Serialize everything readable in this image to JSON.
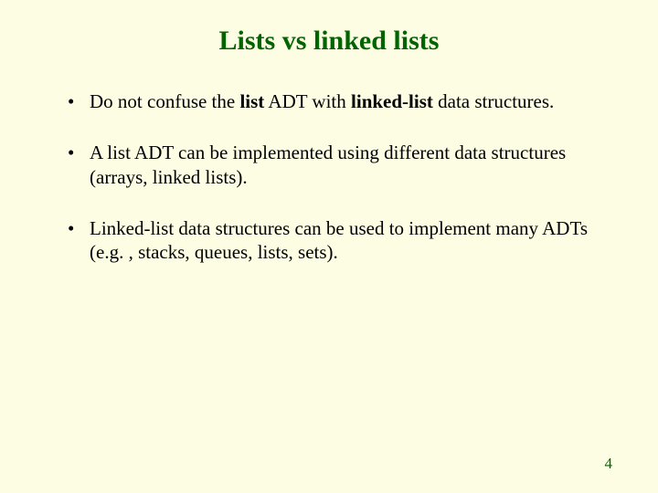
{
  "title": "Lists vs linked lists",
  "bullets": [
    {
      "pre": "Do not confuse the ",
      "bold1": "list",
      "mid1": " ADT with ",
      "bold2": "linked-list",
      "post": " data structures."
    },
    {
      "text": "A list ADT can be implemented using different data structures (arrays, linked lists)."
    },
    {
      "text": "Linked-list data structures can be used to implement many ADTs (e.g. , stacks, queues, lists, sets)."
    }
  ],
  "page_number": "4"
}
